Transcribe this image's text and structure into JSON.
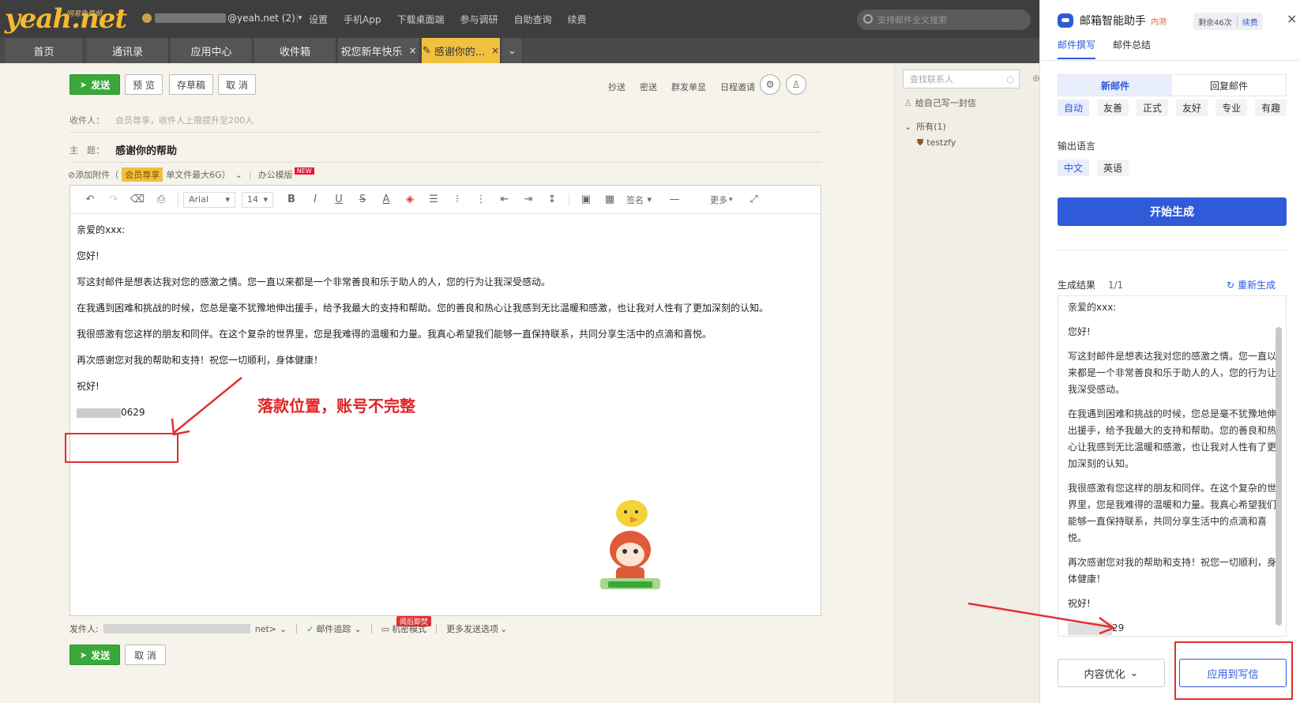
{
  "header": {
    "logo": "yeah.net",
    "logo_sub": "网易免费邮",
    "account_suffix": "@yeah.net (2)",
    "nav": [
      "设置",
      "手机App",
      "下载桌面端",
      "参与调研",
      "自助查询",
      "续费"
    ],
    "search_placeholder": "支持邮件全文搜索"
  },
  "tabs": [
    {
      "label": "首页"
    },
    {
      "label": "通讯录"
    },
    {
      "label": "应用中心"
    },
    {
      "label": "收件箱"
    },
    {
      "label": "祝您新年快乐",
      "closable": "×"
    },
    {
      "label": "感谢你的...",
      "closable": "×"
    }
  ],
  "compose": {
    "send": "发送",
    "preview": "预 览",
    "draft": "存草稿",
    "cancel": "取 消",
    "options": [
      "抄送",
      "密送",
      "群发单显",
      "日程邀请"
    ],
    "to_label": "收件人：",
    "to_placeholder": "会员尊享，收件人上限提升至200人",
    "subject_label": "主　题：",
    "subject": "感谢你的帮助",
    "attach": "添加附件（",
    "vip": "会员尊享",
    "attach_limit": "单文件最大6G）",
    "office": "办公模版",
    "new_badge": "NEW",
    "font": "Arial",
    "size": "14",
    "signature": "签名",
    "more": "更多",
    "body": [
      "亲爱的xxx:",
      "您好!",
      "写这封邮件是想表达我对您的感激之情。您一直以来都是一个非常善良和乐于助人的人，您的行为让我深受感动。",
      "在我遇到困难和挑战的时候，您总是毫不犹豫地伸出援手，给予我最大的支持和帮助。您的善良和热心让我感到无比温暖和感激，也让我对人性有了更加深刻的认知。",
      "我很感激有您这样的朋友和同伴。在这个复杂的世界里，您是我难得的温暖和力量。我真心希望我们能够一直保持联系，共同分享生活中的点滴和喜悦。",
      "再次感谢您对我的帮助和支持！祝您一切顺利，身体健康！",
      "祝好!"
    ],
    "signature_suffix": "0629",
    "annotation": "落款位置，账号不完整",
    "sender_label": "发件人:",
    "sender_suffix": "net>",
    "tracking": "邮件追踪",
    "secret": "机密模式",
    "burn_badge": "阅后即焚",
    "more_send": "更多发送选项",
    "send2": "发送",
    "cancel2": "取 消"
  },
  "contacts": {
    "search_placeholder": "查找联系人",
    "self": "给自己写一封信",
    "group": "所有(1)",
    "contact": "testzfy"
  },
  "assistant": {
    "title": "邮箱智能助手",
    "beta": "内测",
    "quota": "剩余46次",
    "renew": "续费",
    "close": "×",
    "tabs": [
      "邮件撰写",
      "邮件总结"
    ],
    "modes": [
      "新邮件",
      "回复邮件"
    ],
    "tones": [
      "自动",
      "友善",
      "正式",
      "友好",
      "专业",
      "有趣"
    ],
    "lang_label": "输出语言",
    "langs": [
      "中文",
      "英语"
    ],
    "generate": "开始生成",
    "result_label": "生成结果",
    "result_count": "1/1",
    "regenerate": "重新生成",
    "result": [
      "亲爱的xxx:",
      "您好!",
      "写这封邮件是想表达我对您的感激之情。您一直以来都是一个非常善良和乐于助人的人，您的行为让我深受感动。",
      "在我遇到困难和挑战的时候，您总是毫不犹豫地伸出援手，给予我最大的支持和帮助。您的善良和热心让我感到无比温暖和感激，也让我对人性有了更加深刻的认知。",
      "我很感激有您这样的朋友和同伴。在这个复杂的世界里，您是我难得的温暖和力量。我真心希望我们能够一直保持联系，共同分享生活中的点滴和喜悦。",
      "再次感谢您对我的帮助和支持！祝您一切顺利，身体健康！",
      "祝好!"
    ],
    "result_sig_suffix": "29",
    "optimize": "内容优化",
    "apply": "应用到写信"
  }
}
